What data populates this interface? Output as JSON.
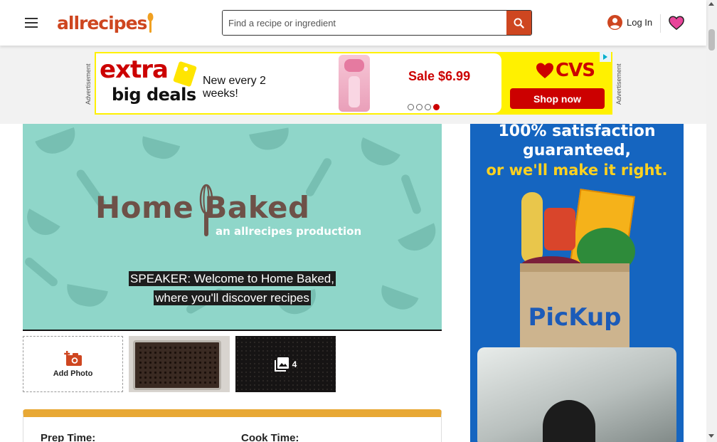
{
  "header": {
    "logo_text": "allrecipes",
    "search_placeholder": "Find a recipe or ingredient",
    "login_label": "Log In"
  },
  "ad_label": "Advertisement",
  "banner_ad": {
    "headline_1": "extra",
    "headline_2": "big deals",
    "tagline": "New every 2 weeks!",
    "price": "Sale $6.99",
    "brand": "CVS",
    "cta": "Shop now",
    "slides_total": 4,
    "active_slide": 4
  },
  "video": {
    "show_title": "Home Baked",
    "show_subtitle": "an allrecipes production",
    "caption_line_1": "SPEAKER: Welcome to Home Baked,",
    "caption_line_2": "where you'll discover recipes"
  },
  "photos": {
    "add_label": "Add Photo",
    "gallery_count": "4"
  },
  "details": {
    "prep_label": "Prep Time:",
    "cook_label": "Cook Time:"
  },
  "right_ad": {
    "line_1": "100% satisfaction",
    "line_2": "guaranteed,",
    "line_3": "or we'll make it right.",
    "brand_text": "PicKup"
  },
  "colors": {
    "brand_orange": "#ce4620",
    "cvs_red": "#cc0000",
    "banner_yellow": "#fff100",
    "card_accent": "#e8a835",
    "right_ad_blue": "#1565c0",
    "video_teal": "#8fd6c9"
  }
}
